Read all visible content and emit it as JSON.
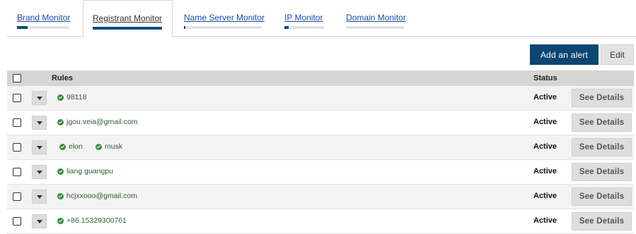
{
  "tabs": [
    {
      "label": "Brand Monitor",
      "active": false,
      "progress": 0.2
    },
    {
      "label": "Registrant Monitor",
      "active": true,
      "progress": 1.0
    },
    {
      "label": "Name Server Monitor",
      "active": false,
      "progress": 0.02
    },
    {
      "label": "IP Monitor",
      "active": false,
      "progress": 0.1
    },
    {
      "label": "Domain Monitor",
      "active": false,
      "progress": 0.0
    }
  ],
  "toolbar": {
    "add_alert_label": "Add an alert",
    "edit_label": "Edit"
  },
  "table": {
    "headers": {
      "rules": "Rules",
      "status": "Status"
    },
    "rows": [
      {
        "rules": [
          "98118"
        ],
        "status": "Active",
        "action": "See Details"
      },
      {
        "rules": [
          "jgou.veia@gmail.com"
        ],
        "status": "Active",
        "action": "See Details"
      },
      {
        "rules": [
          "elon",
          "musk"
        ],
        "status": "Active",
        "action": "See Details"
      },
      {
        "rules": [
          "liang guangpu"
        ],
        "status": "Active",
        "action": "See Details"
      },
      {
        "rules": [
          "hcjxxooo@gmail.com"
        ],
        "status": "Active",
        "action": "See Details"
      },
      {
        "rules": [
          "+86.15329300761"
        ],
        "status": "Active",
        "action": "See Details"
      }
    ]
  },
  "colors": {
    "accent": "#0c4671",
    "link": "#1a4aa8",
    "rule_text": "#2e5b2e",
    "check": "#3a8a3a"
  },
  "icons": {
    "rule_icon": "check-circle-icon",
    "row_menu_icon": "caret-down-icon"
  }
}
